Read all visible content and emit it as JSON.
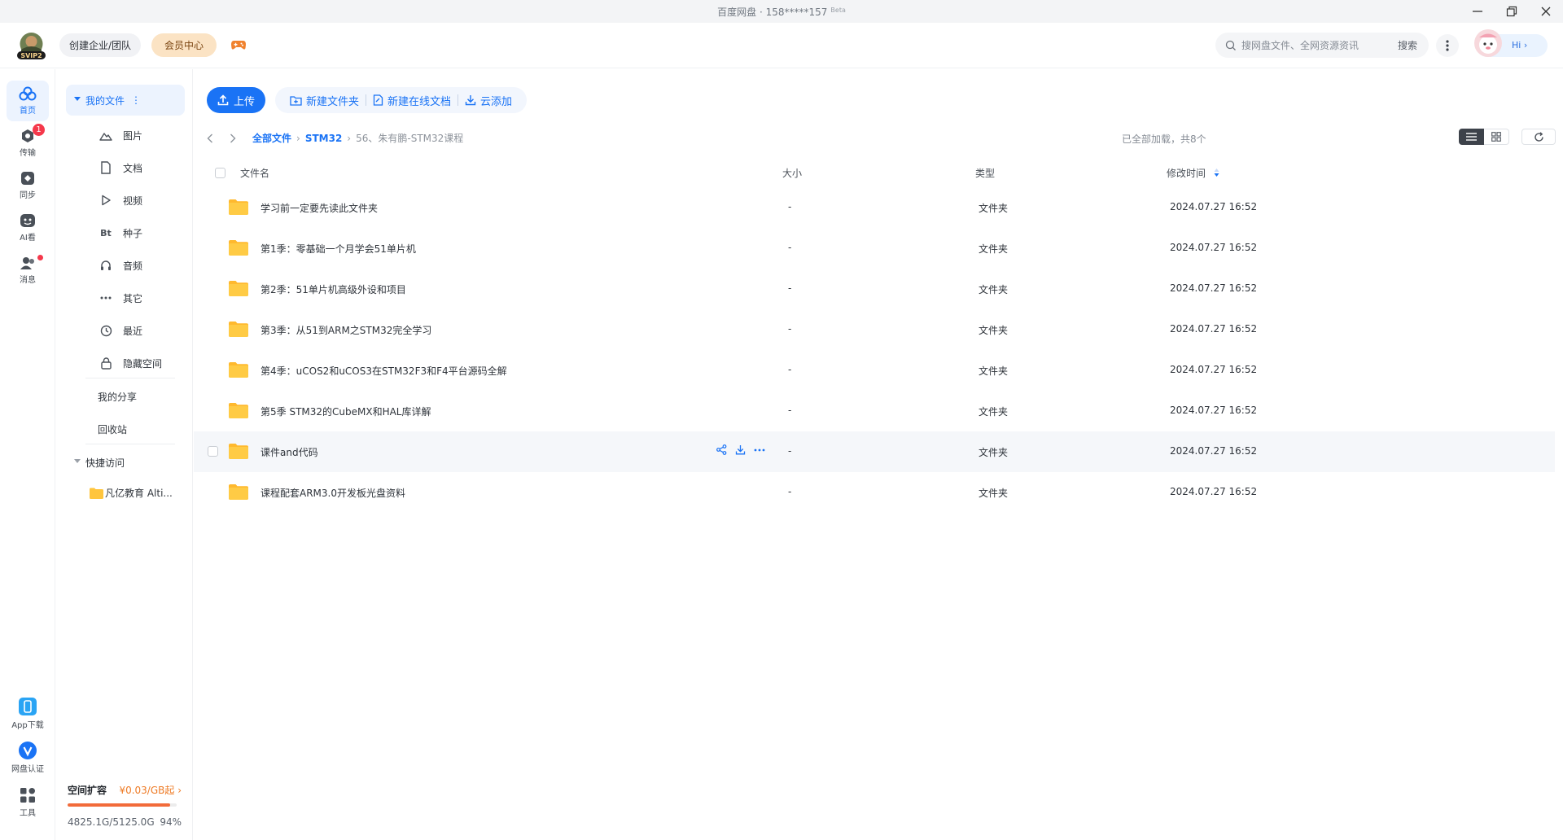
{
  "window": {
    "title": "百度网盘 · 158*****157",
    "beta": "Beta"
  },
  "header": {
    "logo_text": "SVIP2",
    "enterprise_label": "创建企业/团队",
    "vip_label": "会员中心",
    "search_placeholder": "搜网盘文件、全网资源资讯",
    "search_button": "搜索",
    "user_greeting": "Hi"
  },
  "rail": {
    "items": [
      {
        "label": "首页"
      },
      {
        "label": "传输",
        "badge": "1"
      },
      {
        "label": "同步"
      },
      {
        "label": "AI看"
      },
      {
        "label": "消息"
      },
      {
        "label": "App下载"
      },
      {
        "label": "网盘认证"
      },
      {
        "label": "工具"
      }
    ]
  },
  "sidenav": {
    "my_files": "我的文件",
    "categories": [
      {
        "label": "图片",
        "icon": "image-icon"
      },
      {
        "label": "文档",
        "icon": "document-icon"
      },
      {
        "label": "视频",
        "icon": "play-icon"
      },
      {
        "label": "种子",
        "icon": "bt-icon",
        "glyph": "Bt"
      },
      {
        "label": "音频",
        "icon": "headphones-icon"
      },
      {
        "label": "其它",
        "icon": "more-icon"
      },
      {
        "label": "最近",
        "icon": "clock-icon"
      },
      {
        "label": "隐藏空间",
        "icon": "lock-icon"
      }
    ],
    "my_share": "我的分享",
    "recycle_bin": "回收站",
    "quick_access": "快捷访问",
    "quick_items": [
      {
        "label": "凡亿教育 Alti..."
      }
    ],
    "storage": {
      "title": "空间扩容",
      "price": "¥0.03/GB起",
      "used": "4825.1G/5125.0G",
      "percent_label": "94%",
      "percent": 94
    }
  },
  "toolbar": {
    "upload": "上传",
    "new_folder": "新建文件夹",
    "new_online_doc": "新建在线文档",
    "cloud_add": "云添加"
  },
  "breadcrumb": {
    "items": [
      "全部文件",
      "STM32",
      "56、朱有鹏-STM32课程"
    ]
  },
  "list_info": "已全部加载，共8个",
  "table": {
    "headers": {
      "name": "文件名",
      "size": "大小",
      "type": "类型",
      "mtime": "修改时间"
    },
    "rows": [
      {
        "name": "学习前一定要先读此文件夹",
        "size": "-",
        "type": "文件夹",
        "mtime": "2024.07.27 16:52"
      },
      {
        "name": "第1季：零基础一个月学会51单片机",
        "size": "-",
        "type": "文件夹",
        "mtime": "2024.07.27 16:52"
      },
      {
        "name": "第2季：51单片机高级外设和项目",
        "size": "-",
        "type": "文件夹",
        "mtime": "2024.07.27 16:52"
      },
      {
        "name": "第3季：从51到ARM之STM32完全学习",
        "size": "-",
        "type": "文件夹",
        "mtime": "2024.07.27 16:52"
      },
      {
        "name": "第4季：uCOS2和uCOS3在STM32F3和F4平台源码全解",
        "size": "-",
        "type": "文件夹",
        "mtime": "2024.07.27 16:52"
      },
      {
        "name": "第5季 STM32的CubeMX和HAL库详解",
        "size": "-",
        "type": "文件夹",
        "mtime": "2024.07.27 16:52"
      },
      {
        "name": "课件and代码",
        "size": "-",
        "type": "文件夹",
        "mtime": "2024.07.27 16:52",
        "hover": true
      },
      {
        "name": "课程配套ARM3.0开发板光盘资料",
        "size": "-",
        "type": "文件夹",
        "mtime": "2024.07.27 16:52"
      }
    ]
  },
  "colors": {
    "accent": "#1a73f5",
    "folder": "#ffc53d",
    "badge": "#f5384b",
    "storage_bar": "#f26b3a"
  }
}
